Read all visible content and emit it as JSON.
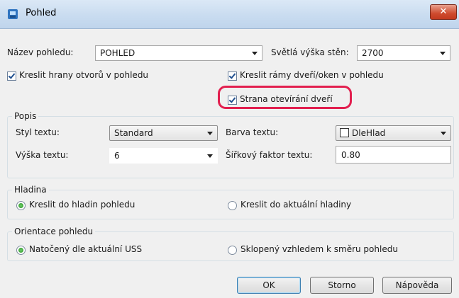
{
  "window": {
    "title": "Pohled",
    "close_label": "✕"
  },
  "fields": {
    "view_name_label": "Název pohledu:",
    "view_name_value": "POHLED",
    "clear_height_label": "Světlá výška stěn:",
    "clear_height_value": "2700"
  },
  "checkboxes": {
    "draw_opening_edges": "Kreslit hrany otvorů v pohledu",
    "draw_door_frames": "Kreslit rámy dveří/oken v pohledu",
    "door_opening_side": "Strana otevírání dveří"
  },
  "popis": {
    "title": "Popis",
    "text_style_label": "Styl textu:",
    "text_style_value": "Standard",
    "text_color_label": "Barva textu:",
    "text_color_value": "DleHlad",
    "text_height_label": "Výška textu:",
    "text_height_value": "6",
    "width_factor_label": "Šířkový faktor textu:",
    "width_factor_value": "0.80"
  },
  "hladina": {
    "title": "Hladina",
    "option_view_layers": "Kreslit do hladin pohledu",
    "option_current_layer": "Kreslit do aktuální hladiny"
  },
  "orientace": {
    "title": "Orientace pohledu",
    "option_rotated": "Natočený dle aktuální USS",
    "option_tilted": "Sklopený vzhledem k směru pohledu"
  },
  "buttons": {
    "ok": "OK",
    "cancel": "Storno",
    "help": "Nápověda"
  },
  "colors": {
    "highlight": "#e21f4f",
    "titlebar": "#c9dcf0"
  }
}
